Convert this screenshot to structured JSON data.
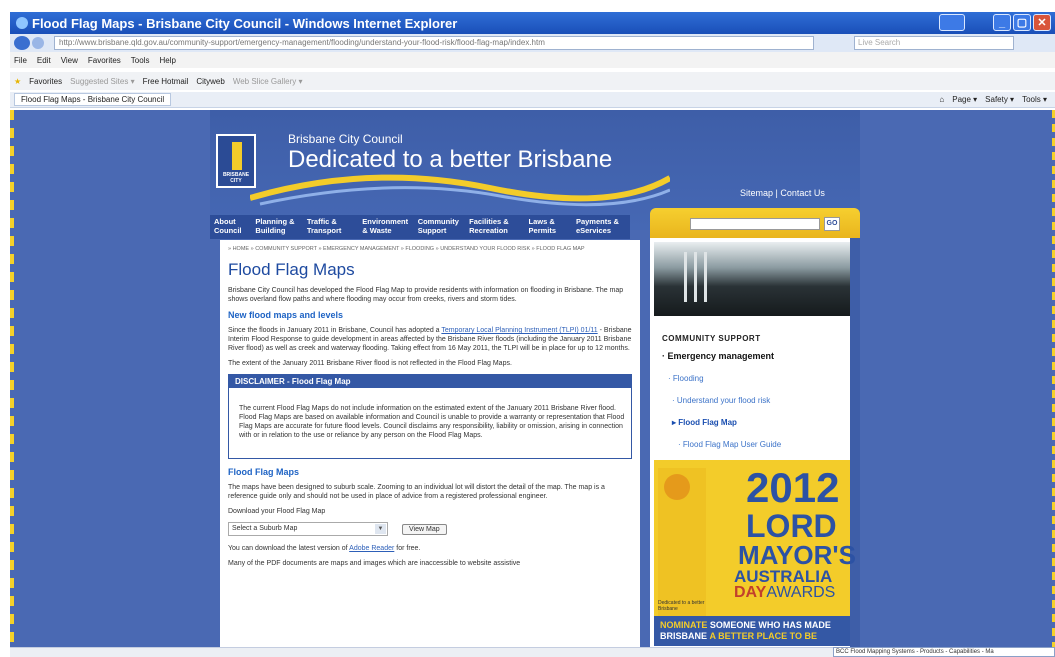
{
  "window": {
    "title": "Flood Flag Maps - Brisbane City Council - Windows Internet Explorer"
  },
  "address": {
    "url": "http://www.brisbane.qld.gov.au/community-support/emergency-management/flooding/understand-your-flood-risk/flood-flag-map/index.htm",
    "search_placeholder": "Live Search"
  },
  "menu": [
    "File",
    "Edit",
    "View",
    "Favorites",
    "Tools",
    "Help"
  ],
  "favorites": {
    "label": "Favorites",
    "items": [
      "Suggested Sites ▾",
      "Free Hotmail",
      "Cityweb",
      "Web Slice Gallery ▾"
    ]
  },
  "tab": {
    "label": "Flood Flag Maps - Brisbane City Council",
    "tools": [
      "Page ▾",
      "Safety ▾",
      "Tools ▾"
    ]
  },
  "site": {
    "council_name": "Brisbane City Council",
    "tagline": "Dedicated to a better Brisbane",
    "logo_text": "BRISBANE CITY",
    "util_links": "Sitemap | Contact Us",
    "search_go": "GO",
    "nav": [
      "About Council",
      "Planning & Building",
      "Traffic & Transport",
      "Environment & Waste",
      "Community Support",
      "Facilities & Recreation",
      "Laws & Permits",
      "Payments & eServices"
    ]
  },
  "content": {
    "breadcrumb": "» HOME » COMMUNITY SUPPORT » EMERGENCY MANAGEMENT » FLOODING » UNDERSTAND YOUR FLOOD RISK » FLOOD FLAG MAP",
    "title": "Flood Flag Maps",
    "intro": "Brisbane City Council has developed the Flood Flag Map to provide residents with information on flooding in Brisbane. The map shows overland flow paths and where flooding may occur from creeks, rivers and storm tides.",
    "section1_title": "New flood maps and levels",
    "section1_text_a": "Since the floods in January 2011 in Brisbane, Council has adopted a ",
    "section1_link": "Temporary Local Planning Instrument (TLPI) 01/11",
    "section1_text_b": " - Brisbane Interim Flood Response to guide development in areas affected by the Brisbane River floods (including the January 2011 Brisbane River flood) as well as creek and waterway flooding. Taking effect from 16 May 2011, the TLPI will be in place for up to 12 months.",
    "section1_note": "The extent of the January 2011 Brisbane River flood is not reflected in the Flood Flag Maps.",
    "disclaimer_title": "DISCLAIMER - Flood Flag Map",
    "disclaimer_text": "The current Flood Flag Maps do not include information on the estimated extent of the January 2011 Brisbane River flood. Flood Flag Maps are based on available information and Council is unable to provide a warranty or representation that Flood Flag Maps are accurate for future flood levels. Council disclaims any responsibility, liability or omission, arising in connection with or in relation to the use or reliance by any person on the Flood Flag Maps.",
    "section2_title": "Flood Flag Maps",
    "section2_text": "The maps have been designed to suburb scale. Zooming to an individual lot will distort the detail of the map. The map is a reference guide only and should not be used in place of advice from a registered professional engineer.",
    "download_label": "Download your Flood Flag Map",
    "select_value": "Select a Suburb Map",
    "view_button": "View Map",
    "adobe_text_a": "You can download the latest version of ",
    "adobe_link": "Adobe Reader",
    "adobe_text_b": " for free.",
    "footer_text": "Many of the PDF documents are maps and images which are inaccessible to website assistive"
  },
  "sidebar": {
    "heading": "COMMUNITY SUPPORT",
    "items": [
      "Emergency management",
      "Flooding",
      "Understand your flood risk",
      "Flood Flag Map",
      "Flood Flag Map User Guide"
    ]
  },
  "banner": {
    "year": "2012",
    "line1": "LORD",
    "line2": "MAYOR'S",
    "line3": "AUSTRALIA",
    "line4a": "DAY",
    "line4b": "AWARDS",
    "small_text": "Dedicated to a better Brisbane",
    "nominate_a": "NOMINATE",
    "nominate_b": " SOMEONE WHO HAS MADE",
    "nominate_c": "BRISBANE ",
    "nominate_d": "A BETTER PLACE TO BE"
  },
  "statusbar": {
    "taskbar_hint": "BCC Flood Mapping Systems - Products - Capabilities - Ma"
  }
}
